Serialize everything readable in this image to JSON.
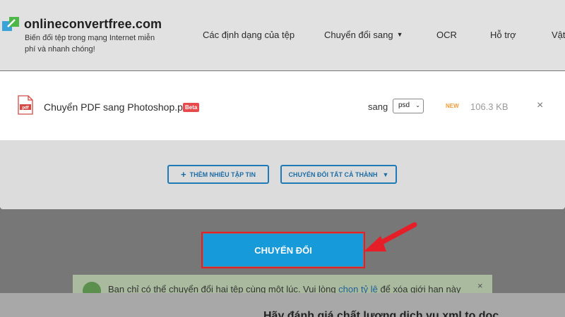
{
  "header": {
    "logo_title": "onlineconvertfree.com",
    "logo_tagline": "Biến đổi tệp trong mạng Internet miễn phí và nhanh chóng!",
    "nav": [
      {
        "label": "Các định dạng của tệp"
      },
      {
        "label": "Chuyển đổi sang",
        "has_dropdown": true
      },
      {
        "label": "OCR"
      },
      {
        "label": "Hỗ trợ"
      },
      {
        "label": "Vật"
      }
    ]
  },
  "file": {
    "name": "Chuyển PDF sang Photoshop.pdf",
    "badge": "Beta",
    "to_label": "sang",
    "format": "psd",
    "new_label": "NEW",
    "size": "106.3 KB",
    "close_glyph": "×"
  },
  "actions": {
    "add_more": "THÊM NHIỀU TẬP TIN",
    "add_more_glyph": "+",
    "convert_all": "CHUYỂN ĐỔI TẤT CẢ THÀNH",
    "convert": "CHUYỂN ĐỔI"
  },
  "notice": {
    "text_before": "Bạn chỉ có thể chuyển đổi hai tệp cùng một lúc. Vui lòng ",
    "link": "chọn tỷ lệ",
    "text_after": " để xóa giới hạn này",
    "close_glyph": "×"
  },
  "rating": {
    "title": "Hãy đánh giá chất lượng dịch vụ xml to doc"
  },
  "colors": {
    "convert_button": "#169ada",
    "highlight_border": "#e61e27",
    "beta_badge": "#e8494b",
    "new_badge": "#f39b35",
    "outline_button": "#1e7bb8"
  }
}
